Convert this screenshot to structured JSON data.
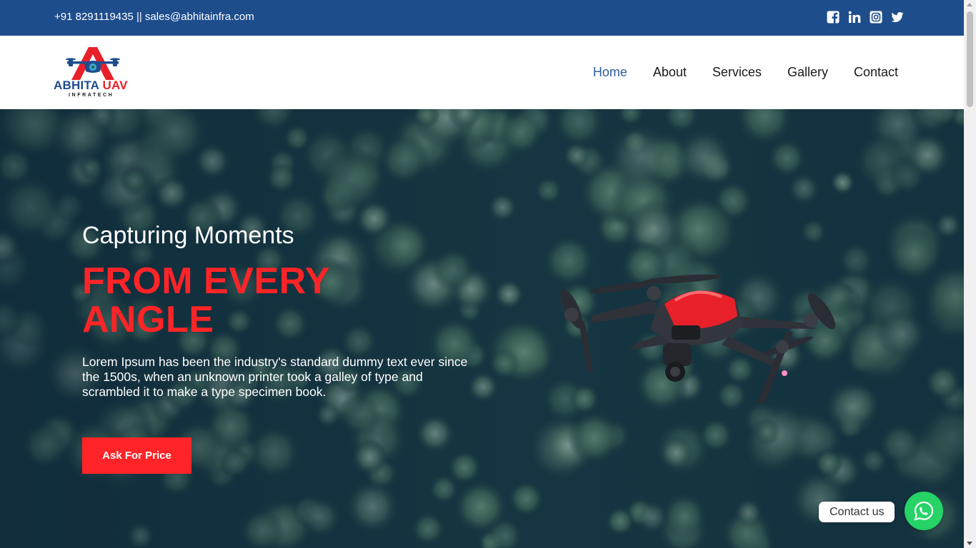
{
  "topbar": {
    "contact": "+91 8291119435 || sales@abhitainfra.com",
    "social": [
      "facebook-icon",
      "linkedin-icon",
      "instagram-icon",
      "twitter-icon"
    ]
  },
  "brand": {
    "name_part1": "ABHITA",
    "name_part2": "UAV",
    "tagline": "INFRATECH"
  },
  "nav": {
    "items": [
      "Home",
      "About",
      "Services",
      "Gallery",
      "Contact"
    ],
    "active": "Home"
  },
  "hero": {
    "subtitle": "Capturing Moments",
    "title_line1": "FROM EVERY",
    "title_line2": "ANGLE",
    "text": "Lorem Ipsum has been the industry's standard dummy text ever since the 1500s, when an unknown printer took a galley of type and scrambled it to make a type specimen book.",
    "cta": "Ask For Price"
  },
  "whatsapp": {
    "label": "Contact us",
    "icon": "whatsapp-icon"
  },
  "colors": {
    "topbar": "#1e4d8c",
    "accent_red": "#ff2427",
    "nav_active": "#2e5f9e",
    "whatsapp": "#25d366"
  }
}
